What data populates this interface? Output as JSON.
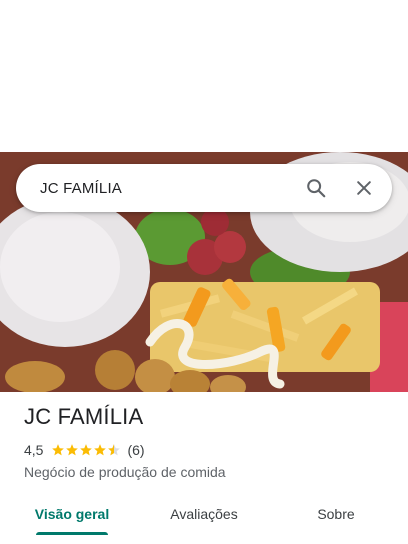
{
  "search": {
    "query": "JC FAMÍLIA",
    "search_icon": "search-icon",
    "close_icon": "close-icon"
  },
  "hero_photo": {
    "description_icon": "food-photo"
  },
  "place": {
    "name": "JC FAMÍLIA",
    "rating": "4,5",
    "rating_value": 4.5,
    "rating_max": 5,
    "review_count": "(6)",
    "category": "Negócio de produção de comida",
    "star_color": "#fbbc04"
  },
  "tabs": [
    {
      "label": "Visão geral",
      "active": true
    },
    {
      "label": "Avaliações",
      "active": false
    },
    {
      "label": "Sobre",
      "active": false
    }
  ],
  "colors": {
    "accent": "#00796b",
    "text_primary": "#202124",
    "text_secondary": "#5f6368"
  }
}
